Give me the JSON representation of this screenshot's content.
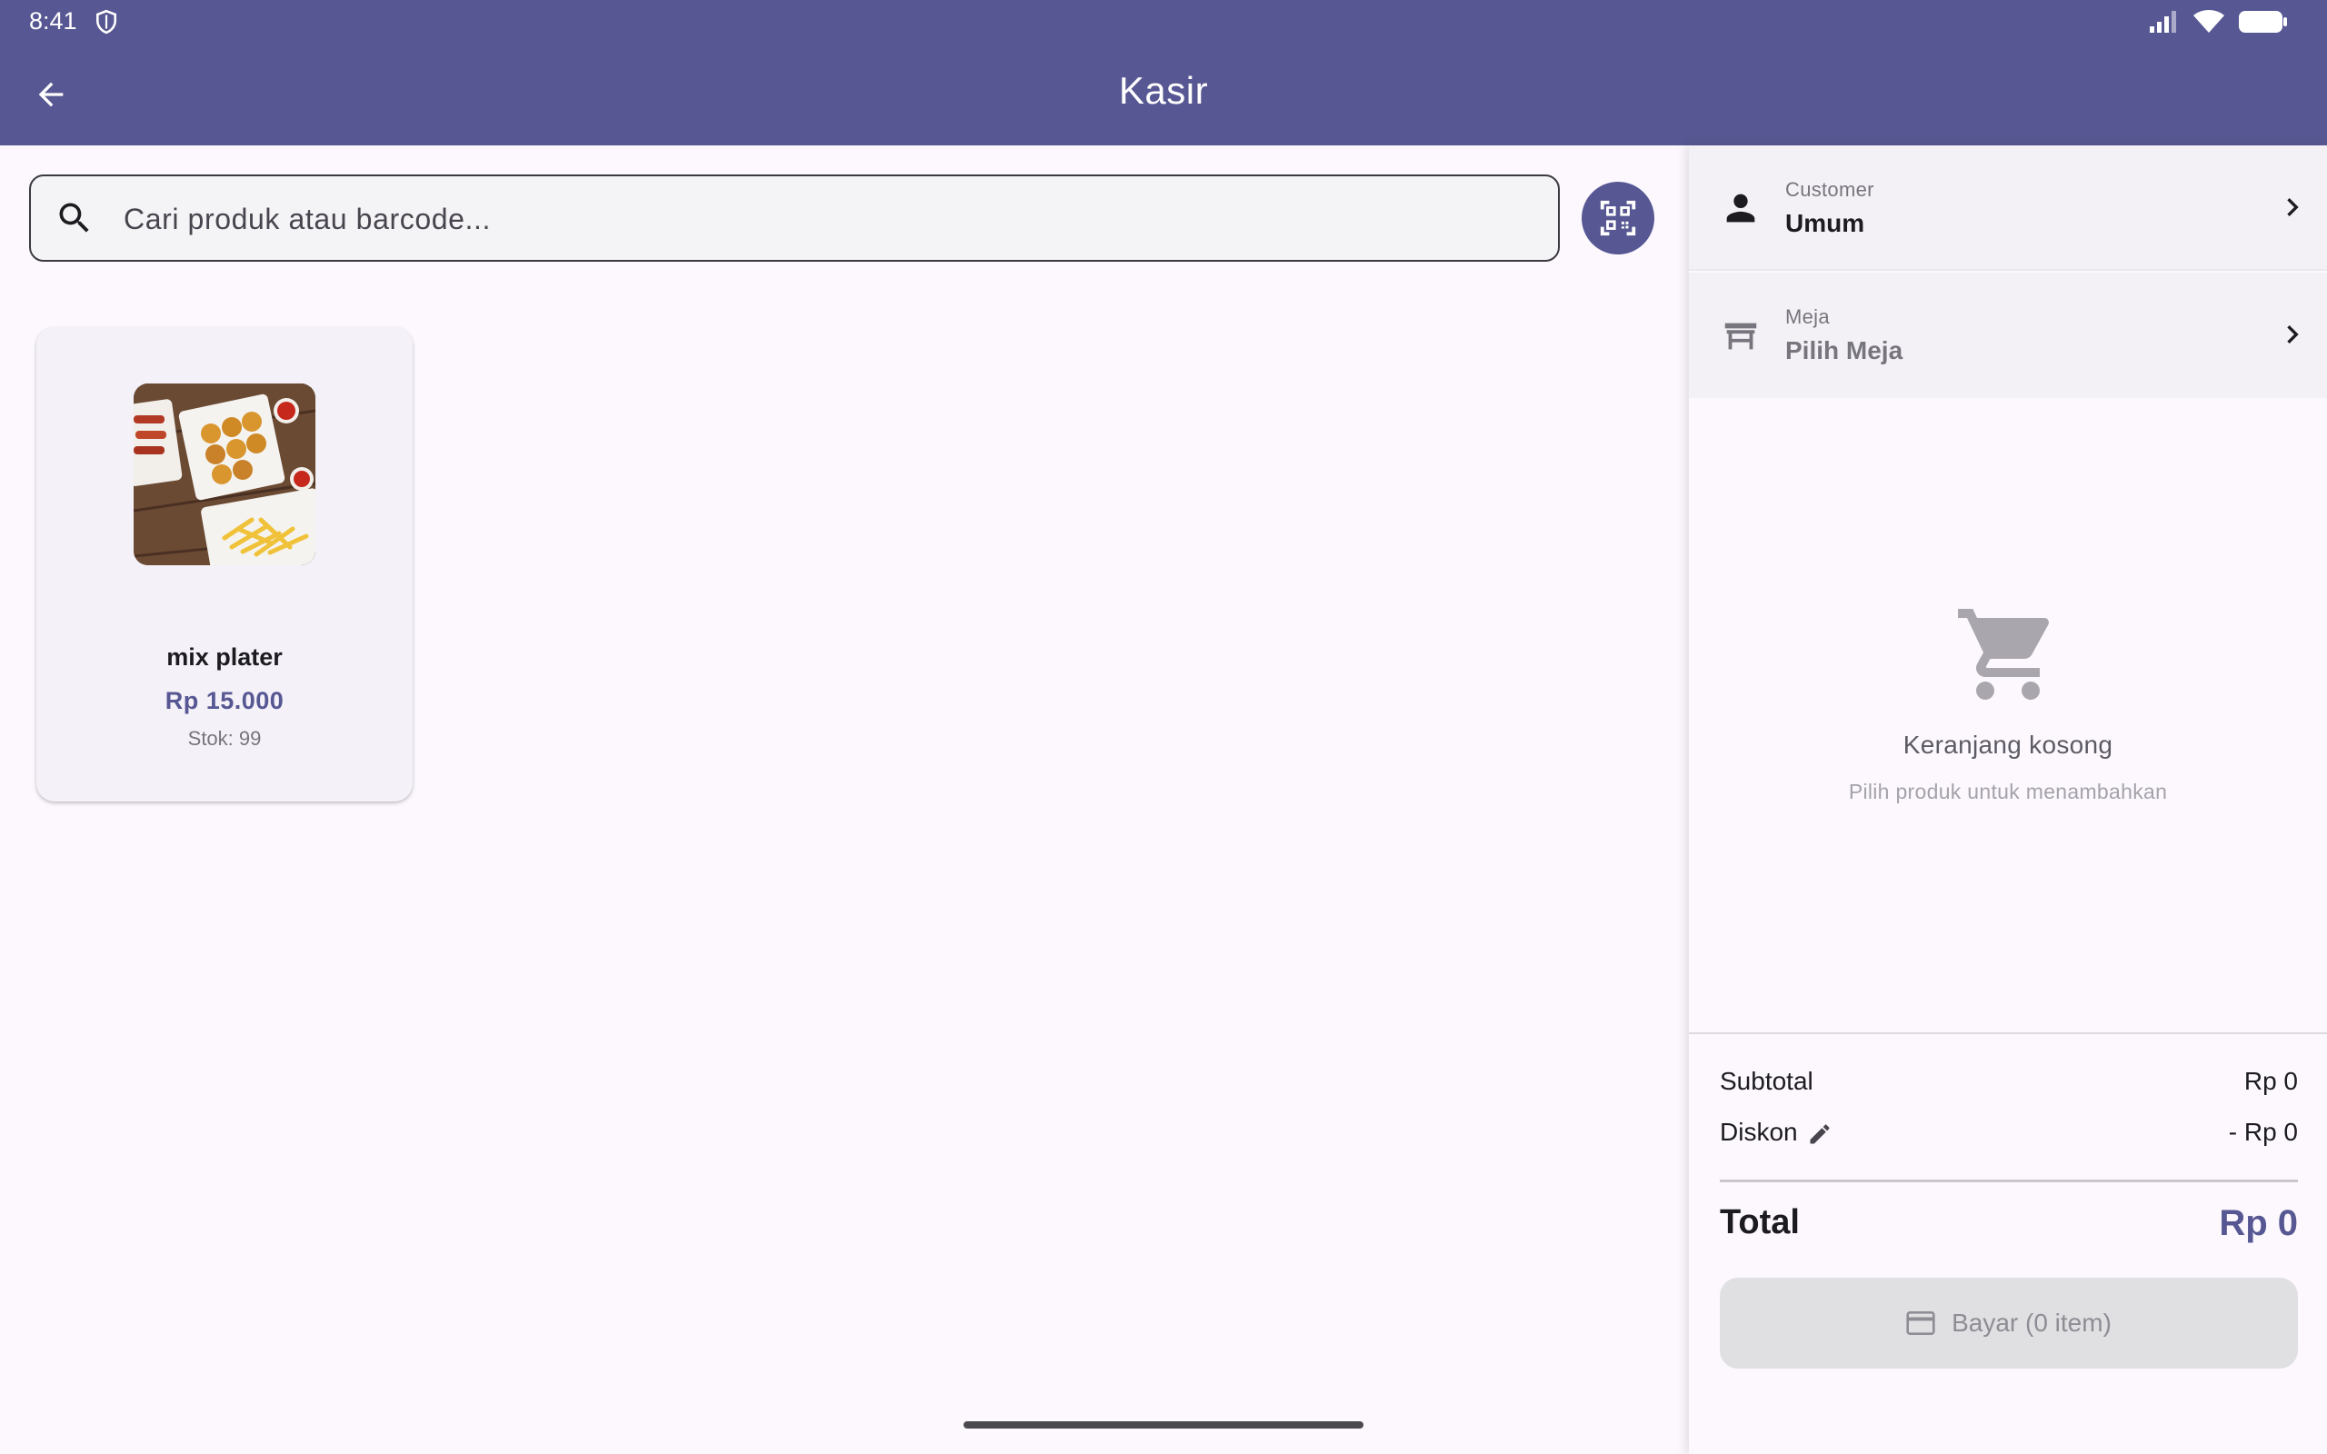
{
  "status_bar": {
    "time": "8:41"
  },
  "app_bar": {
    "title": "Kasir"
  },
  "search": {
    "placeholder": "Cari produk atau barcode...",
    "value": ""
  },
  "products": [
    {
      "name": "mix plater",
      "price": "Rp 15.000",
      "stock": "Stok: 99"
    }
  ],
  "customer": {
    "label": "Customer",
    "value": "Umum"
  },
  "table": {
    "label": "Meja",
    "value": "Pilih Meja"
  },
  "cart": {
    "empty_title": "Keranjang kosong",
    "empty_subtitle": "Pilih produk untuk menambahkan"
  },
  "summary": {
    "subtotal_label": "Subtotal",
    "subtotal_value": "Rp 0",
    "discount_label": "Diskon",
    "discount_value": "- Rp 0",
    "total_label": "Total",
    "total_value": "Rp 0"
  },
  "pay_button": {
    "label": "Bayar (0 item)"
  },
  "colors": {
    "primary": "#575793",
    "background": "#fcf8fe",
    "panel": "#f4f1f6"
  }
}
